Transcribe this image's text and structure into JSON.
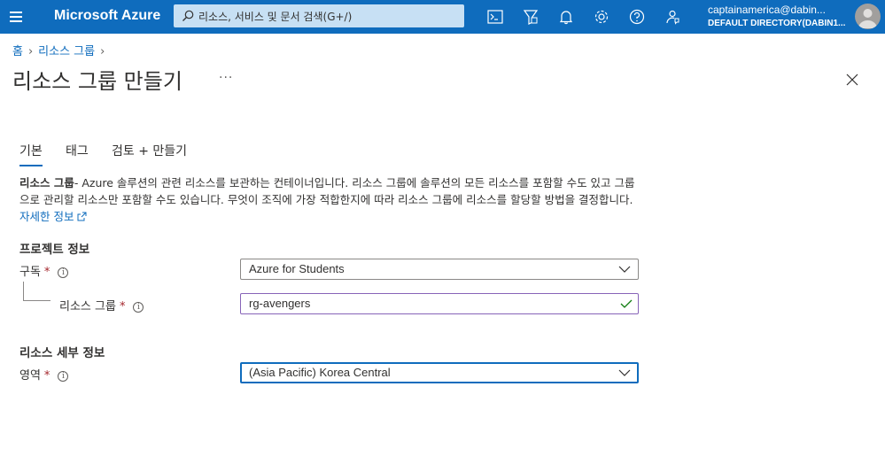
{
  "topbar": {
    "brand": "Microsoft Azure",
    "search_placeholder": "리소스, 서비스 및 문서 검색(G+/)",
    "account_email": "captainamerica@dabin...",
    "account_directory": "DEFAULT DIRECTORY(DABIN1...",
    "icons": [
      "cloud-shell-icon",
      "directory-filter-icon",
      "notifications-icon",
      "settings-icon",
      "help-icon",
      "feedback-icon"
    ]
  },
  "breadcrumb": {
    "home": "홈",
    "resource_groups": "리소스 그룹"
  },
  "page": {
    "title": "리소스 그룹 만들기",
    "more": "···"
  },
  "tabs": [
    {
      "label": "기본",
      "active": true
    },
    {
      "label": "태그",
      "active": false
    },
    {
      "label": "검토 + 만들기",
      "active": false
    }
  ],
  "description": {
    "bold": "리소스 그룹",
    "text": "- Azure 솔루션의 관련 리소스를 보관하는 컨테이너입니다. 리소스 그룹에 솔루션의 모든 리소스를 포함할 수도 있고 그룹으로 관리할 리소스만 포함할 수도 있습니다. 무엇이 조직에 가장 적합한지에 따라 리소스 그룹에 리소스를 할당할 방법을 결정합니다. ",
    "link": "자세한 정보"
  },
  "project_section": {
    "title": "프로젝트 정보",
    "subscription_label": "구독",
    "subscription_value": "Azure for Students",
    "resource_group_label": "리소스 그룹",
    "resource_group_value": "rg-avengers"
  },
  "resource_section": {
    "title": "리소스 세부 정보",
    "region_label": "영역",
    "region_value": "(Asia Pacific) Korea Central"
  },
  "required_mark": "*",
  "info_glyph": "i",
  "colors": {
    "topbar": "#0f6cbd",
    "link": "#0f6cbd",
    "required": "#a4262c",
    "valid_check": "#107c10"
  }
}
